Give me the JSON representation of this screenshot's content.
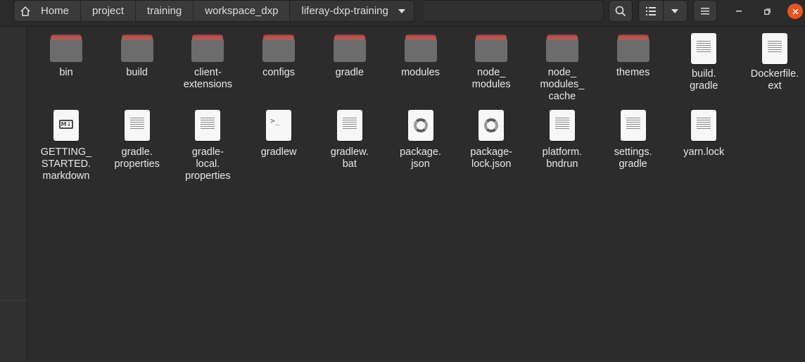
{
  "breadcrumbs": [
    {
      "label": "Home",
      "icon": "home-icon"
    },
    {
      "label": "project"
    },
    {
      "label": "training"
    },
    {
      "label": "workspace_dxp"
    },
    {
      "label": "liferay-dxp-training"
    }
  ],
  "header_buttons": {
    "search": "search-icon",
    "view": "list-view-icon",
    "view_options": "chevron-down-icon",
    "menu": "hamburger-menu-icon"
  },
  "window_controls": [
    "minimize",
    "maximize",
    "close"
  ],
  "colors": {
    "accent_close": "#e95420",
    "folder_tab": "#c34f3f",
    "folder_body": "#6c6c6c"
  },
  "files": [
    {
      "name": "bin",
      "type": "folder"
    },
    {
      "name": "build",
      "type": "folder"
    },
    {
      "name": "client-\nextensions",
      "type": "folder"
    },
    {
      "name": "configs",
      "type": "folder"
    },
    {
      "name": "gradle",
      "type": "folder"
    },
    {
      "name": "modules",
      "type": "folder"
    },
    {
      "name": "node_\nmodules",
      "type": "folder"
    },
    {
      "name": "node_\nmodules_\ncache",
      "type": "folder"
    },
    {
      "name": "themes",
      "type": "folder"
    },
    {
      "name": "build.\ngradle",
      "type": "text"
    },
    {
      "name": "Dockerfile.\next",
      "type": "text"
    },
    {
      "name": "GETTING_\nSTARTED.\nmarkdown",
      "type": "markdown"
    },
    {
      "name": "gradle.\nproperties",
      "type": "text"
    },
    {
      "name": "gradle-\nlocal.\nproperties",
      "type": "text"
    },
    {
      "name": "gradlew",
      "type": "script"
    },
    {
      "name": "gradlew.\nbat",
      "type": "text"
    },
    {
      "name": "package.\njson",
      "type": "json"
    },
    {
      "name": "package-\nlock.json",
      "type": "json"
    },
    {
      "name": "platform.\nbndrun",
      "type": "text"
    },
    {
      "name": "settings.\ngradle",
      "type": "text"
    },
    {
      "name": "yarn.lock",
      "type": "text"
    }
  ]
}
